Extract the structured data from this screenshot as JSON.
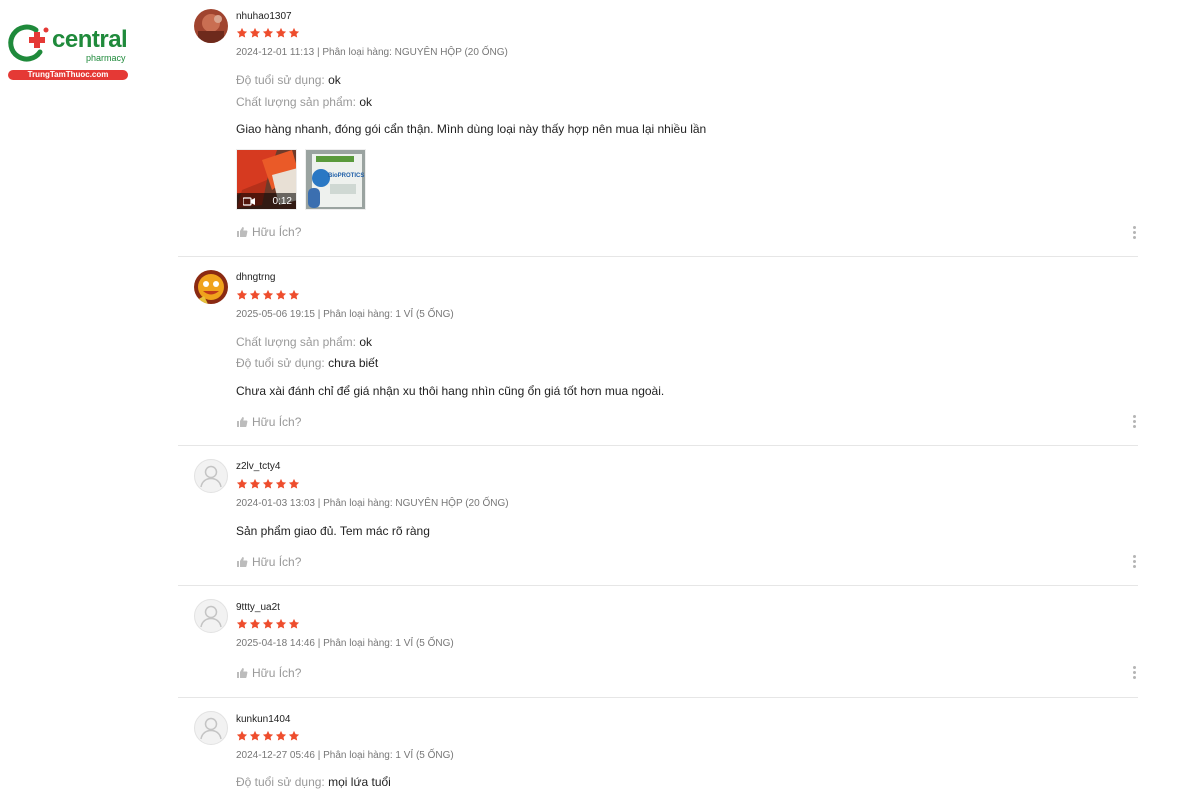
{
  "logo": {
    "brand": "central",
    "sub": "pharmacy",
    "site": "TrungTamThuoc.com",
    "colors": {
      "green": "#1f8a3b",
      "red": "#e53935"
    }
  },
  "colors": {
    "star": "#ee4d2d",
    "muted": "#999999",
    "text": "#222222"
  },
  "helpful_label": "Hữu Ích?",
  "reviews": [
    {
      "username": "nhuhao1307",
      "rating": 5,
      "meta": "2024-12-01 11:13 | Phân loại hàng: NGUYÊN HỘP (20 ỐNG)",
      "attrs": [
        {
          "label": "Độ tuổi sử dụng:",
          "value": "ok"
        },
        {
          "label": "Chất lượng sản phẩm:",
          "value": "ok"
        }
      ],
      "content": "Giao hàng nhanh, đóng gói cẩn thận. Mình dùng loại này thấy hợp nên mua lại nhiều lần",
      "media": {
        "video_duration": "0:12",
        "image_label": "BioPROTICS"
      }
    },
    {
      "username": "dhngtrng",
      "rating": 5,
      "meta": "2025-05-06 19:15 | Phân loại hàng: 1 VỈ (5 ỐNG)",
      "attrs": [
        {
          "label": "Chất lượng sản phẩm:",
          "value": "ok"
        },
        {
          "label": "Độ tuổi sử dụng:",
          "value": "chưa biết"
        }
      ],
      "content": "Chưa xài đánh chỉ để giá nhận xu thôi hang nhìn cũng ổn giá tốt hơn mua ngoài."
    },
    {
      "username": "z2lv_tcty4",
      "rating": 5,
      "meta": "2024-01-03 13:03 | Phân loại hàng: NGUYÊN HỘP (20 ỐNG)",
      "attrs": [],
      "content": "Sản phẩm giao đủ. Tem mác rõ ràng"
    },
    {
      "username": "9ttty_ua2t",
      "rating": 5,
      "meta": "2025-04-18 14:46 | Phân loại hàng: 1 VỈ (5 ỐNG)",
      "attrs": [],
      "content": ""
    },
    {
      "username": "kunkun1404",
      "rating": 5,
      "meta": "2024-12-27 05:46 | Phân loại hàng: 1 VỈ (5 ỐNG)",
      "attrs": [
        {
          "label": "Độ tuổi sử dụng:",
          "value": "mọi lứa tuổi"
        }
      ],
      "content": ""
    }
  ]
}
